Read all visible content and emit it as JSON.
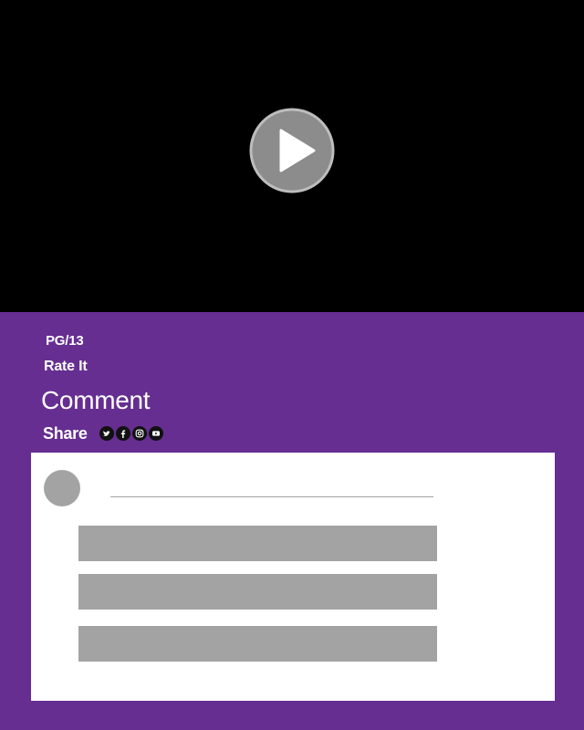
{
  "video": {
    "play_icon": "play-icon",
    "background_color": "#000000"
  },
  "details": {
    "rating": "PG/13",
    "rate_label": "Rate It",
    "comment_label": "Comment",
    "share_label": "Share",
    "social_icons": [
      "twitter-icon",
      "facebook-icon",
      "instagram-icon",
      "youtube-icon"
    ],
    "accent_color": "#662e91"
  },
  "comment_card": {
    "placeholder_color": "#a3a3a3"
  }
}
